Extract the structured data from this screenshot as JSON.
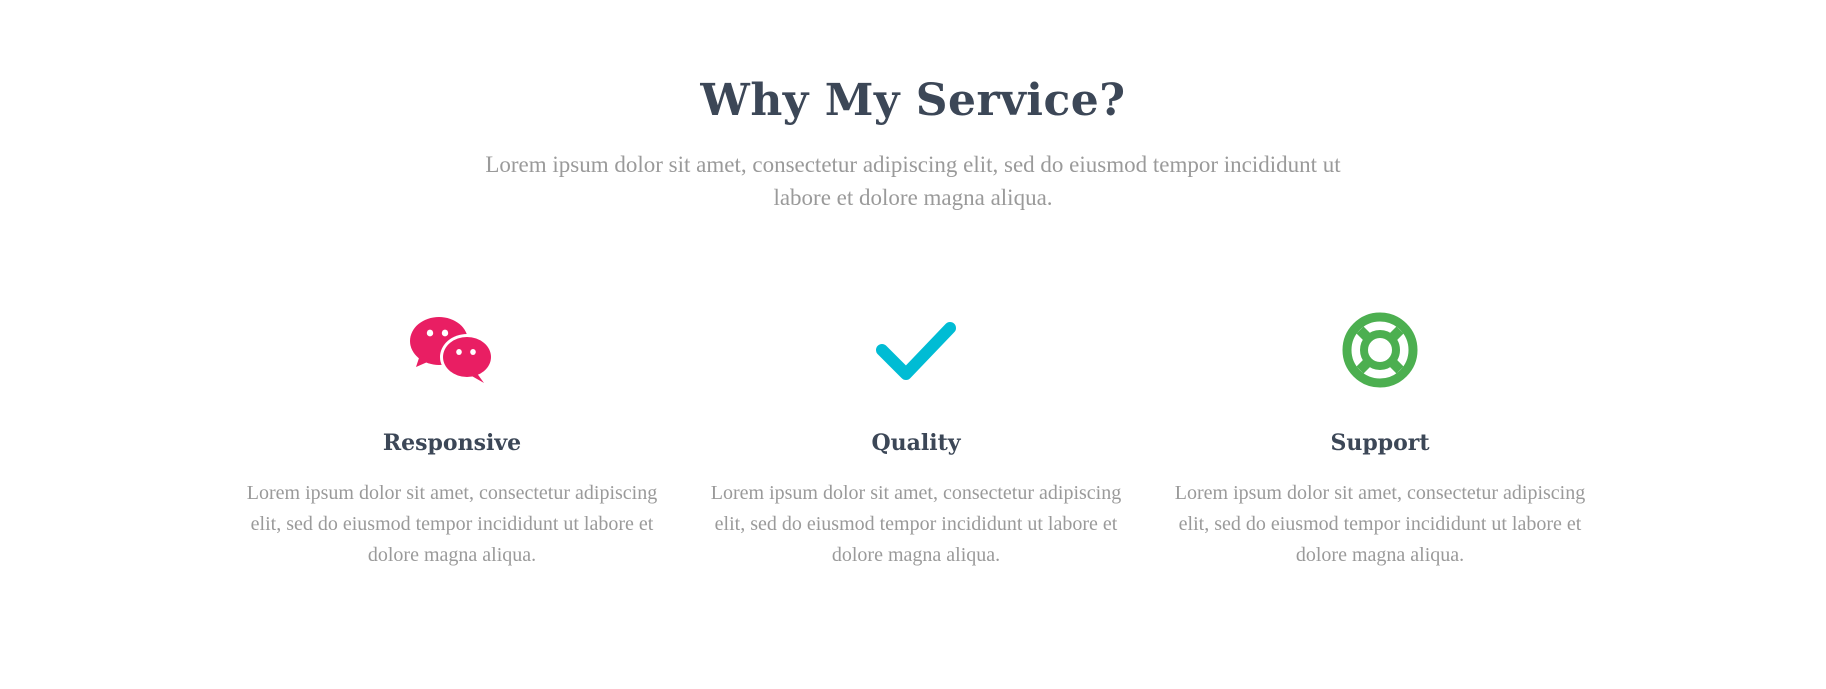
{
  "section": {
    "title": "Why My Service?",
    "subtitle": "Lorem ipsum dolor sit amet, consectetur adipiscing elit, sed do eiusmod tempor incididunt ut labore et dolore magna aliqua."
  },
  "features": [
    {
      "icon": "chat-bubbles-icon",
      "icon_color": "#e91e63",
      "title": "Responsive",
      "text": "Lorem ipsum dolor sit amet, consectetur adipiscing elit, sed do eiusmod tempor incididunt ut labore et dolore magna aliqua."
    },
    {
      "icon": "checkmark-icon",
      "icon_color": "#00bcd4",
      "title": "Quality",
      "text": "Lorem ipsum dolor sit amet, consectetur adipiscing elit, sed do eiusmod tempor incididunt ut labore et dolore magna aliqua."
    },
    {
      "icon": "lifebuoy-icon",
      "icon_color": "#4caf50",
      "title": "Support",
      "text": "Lorem ipsum dolor sit amet, consectetur adipiscing elit, sed do eiusmod tempor incididunt ut labore et dolore magna aliqua."
    }
  ],
  "colors": {
    "heading": "#3c4757",
    "body_text": "#9a9a9a",
    "background": "#ffffff"
  }
}
